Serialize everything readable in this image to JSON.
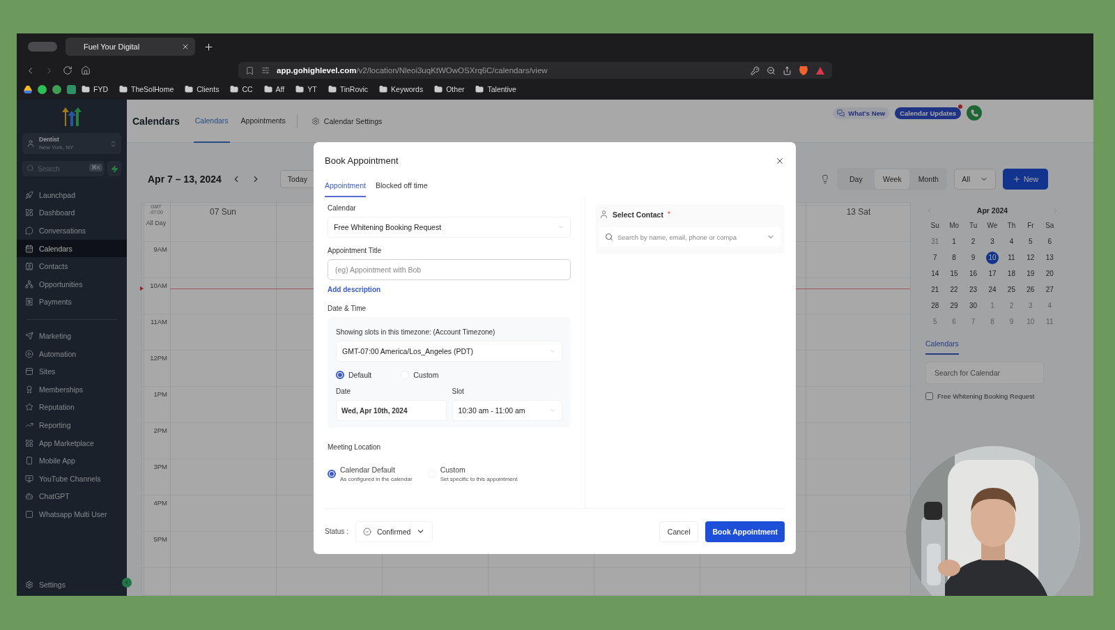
{
  "browser": {
    "tab": {
      "title": "Fuel Your Digital"
    },
    "url": "**app.gohighlevel.com**/v2/location/Nleoi3uqKtWOwOSXrq6C/calendars/view",
    "bookmarks": [
      "FYD",
      "TheSolHome",
      "Clients",
      "CC",
      "Aff",
      "YT",
      "TinRovic",
      "Keywords",
      "Other",
      "Talentive"
    ]
  },
  "sidebar": {
    "account": {
      "name": "Dentist",
      "location": "New York, NY"
    },
    "search": {
      "placeholder": "Search",
      "shortcut": "⌘K"
    },
    "groups": [
      [
        {
          "label": "Launchpad",
          "selected": false
        },
        {
          "label": "Dashboard",
          "selected": false
        },
        {
          "label": "Conversations",
          "selected": false
        },
        {
          "label": "Calendars",
          "selected": true
        },
        {
          "label": "Contacts",
          "selected": false
        },
        {
          "label": "Opportunities",
          "selected": false
        },
        {
          "label": "Payments",
          "selected": false
        }
      ],
      [
        {
          "label": "Marketing",
          "selected": false
        },
        {
          "label": "Automation",
          "selected": false
        },
        {
          "label": "Sites",
          "selected": false
        },
        {
          "label": "Memberships",
          "selected": false
        },
        {
          "label": "Reputation",
          "selected": false
        },
        {
          "label": "Reporting",
          "selected": false
        },
        {
          "label": "App Marketplace",
          "selected": false
        },
        {
          "label": "Mobile App",
          "selected": false
        },
        {
          "label": "YouTube Channels",
          "selected": false
        },
        {
          "label": "ChatGPT",
          "selected": false
        },
        {
          "label": "Whatsapp Multi User",
          "selected": false
        }
      ]
    ],
    "settings": "Settings"
  },
  "header": {
    "title": "Calendars",
    "tabs": [
      {
        "label": "Calendars",
        "selected": true
      },
      {
        "label": "Appointments",
        "selected": false
      }
    ],
    "settings_link": "Calendar Settings",
    "whats_new": "What's New",
    "updates": {
      "label": "Calendar Updates",
      "unread": true
    }
  },
  "toolbar": {
    "range": "Apr 7 – 13, 2024",
    "today": "Today",
    "views": [
      {
        "label": "Day",
        "selected": false
      },
      {
        "label": "Week",
        "selected": true
      },
      {
        "label": "Month",
        "selected": false
      }
    ],
    "filter": "All",
    "new_button": "New"
  },
  "week": {
    "timezone_top": "GMT",
    "timezone_offset": "-07:00",
    "all_day": "All Day",
    "first_day": "07 Sun",
    "last_day": "13 Sat",
    "hours": [
      "9AM",
      "10AM",
      "11AM",
      "12PM",
      "1PM",
      "2PM",
      "3PM",
      "4PM",
      "5PM"
    ]
  },
  "mini_calendar": {
    "title": "Apr 2024",
    "weekdays": [
      "Su",
      "Mo",
      "Tu",
      "We",
      "Th",
      "Fr",
      "Sa"
    ],
    "days": [
      {
        "label": "31",
        "muted": true,
        "selected": false
      },
      {
        "label": "1",
        "muted": false,
        "selected": false
      },
      {
        "label": "2",
        "muted": false,
        "selected": false
      },
      {
        "label": "3",
        "muted": false,
        "selected": false
      },
      {
        "label": "4",
        "muted": false,
        "selected": false
      },
      {
        "label": "5",
        "muted": false,
        "selected": false
      },
      {
        "label": "6",
        "muted": false,
        "selected": false
      },
      {
        "label": "7",
        "muted": false,
        "selected": false
      },
      {
        "label": "8",
        "muted": false,
        "selected": false
      },
      {
        "label": "9",
        "muted": false,
        "selected": false
      },
      {
        "label": "10",
        "muted": false,
        "selected": true
      },
      {
        "label": "11",
        "muted": false,
        "selected": false
      },
      {
        "label": "12",
        "muted": false,
        "selected": false
      },
      {
        "label": "13",
        "muted": false,
        "selected": false
      },
      {
        "label": "14",
        "muted": false,
        "selected": false
      },
      {
        "label": "15",
        "muted": false,
        "selected": false
      },
      {
        "label": "16",
        "muted": false,
        "selected": false
      },
      {
        "label": "17",
        "muted": false,
        "selected": false
      },
      {
        "label": "18",
        "muted": false,
        "selected": false
      },
      {
        "label": "19",
        "muted": false,
        "selected": false
      },
      {
        "label": "20",
        "muted": false,
        "selected": false
      },
      {
        "label": "21",
        "muted": false,
        "selected": false
      },
      {
        "label": "22",
        "muted": false,
        "selected": false
      },
      {
        "label": "23",
        "muted": false,
        "selected": false
      },
      {
        "label": "24",
        "muted": false,
        "selected": false
      },
      {
        "label": "25",
        "muted": false,
        "selected": false
      },
      {
        "label": "26",
        "muted": false,
        "selected": false
      },
      {
        "label": "27",
        "muted": false,
        "selected": false
      },
      {
        "label": "28",
        "muted": false,
        "selected": false
      },
      {
        "label": "29",
        "muted": false,
        "selected": false
      },
      {
        "label": "30",
        "muted": false,
        "selected": false
      },
      {
        "label": "1",
        "muted": true,
        "selected": false
      },
      {
        "label": "2",
        "muted": true,
        "selected": false
      },
      {
        "label": "3",
        "muted": true,
        "selected": false
      },
      {
        "label": "4",
        "muted": true,
        "selected": false
      },
      {
        "label": "5",
        "muted": true,
        "selected": false
      },
      {
        "label": "6",
        "muted": true,
        "selected": false
      },
      {
        "label": "7",
        "muted": true,
        "selected": false
      },
      {
        "label": "8",
        "muted": true,
        "selected": false
      },
      {
        "label": "9",
        "muted": true,
        "selected": false
      },
      {
        "label": "10",
        "muted": true,
        "selected": false
      },
      {
        "label": "11",
        "muted": true,
        "selected": false
      }
    ]
  },
  "calendars_panel": {
    "tab": "Calendars",
    "search": {
      "placeholder": "Search for Calendar"
    },
    "items": [
      {
        "label": "Free Whitening Booking Request",
        "checked": false
      }
    ]
  },
  "modal": {
    "title": "Book Appointment",
    "tabs": [
      {
        "label": "Appointment",
        "selected": true
      },
      {
        "label": "Blocked off time",
        "selected": false
      }
    ],
    "calendar": {
      "label": "Calendar",
      "value": "Free Whitening Booking Request"
    },
    "appointment_title": {
      "label": "Appointment Title",
      "placeholder": "(eg) Appointment with Bob"
    },
    "add_description": "Add description",
    "date_time": {
      "label": "Date & Time",
      "timezone_note": "Showing slots in this timezone: (Account Timezone)",
      "timezone": "GMT-07:00 America/Los_Angeles (PDT)",
      "modes": [
        {
          "label": "Default",
          "selected": true
        },
        {
          "label": "Custom",
          "selected": false
        }
      ],
      "date": {
        "label": "Date",
        "value": "Wed, Apr 10th, 2024"
      },
      "slot": {
        "label": "Slot",
        "value": "10:30 am - 11:00 am"
      }
    },
    "meeting_location": {
      "label": "Meeting Location",
      "options": [
        {
          "label": "Calendar Default",
          "hint": "As configured in the calendar",
          "selected": true
        },
        {
          "label": "Custom",
          "hint": "Set specific to this appointment",
          "selected": false
        }
      ]
    },
    "contact": {
      "label": "Select Contact",
      "required_mark": "*",
      "placeholder": "Search by name, email, phone or compa"
    },
    "status": {
      "label": "Status :",
      "value": "Confirmed"
    },
    "cancel": "Cancel",
    "submit": "Book Appointment"
  }
}
